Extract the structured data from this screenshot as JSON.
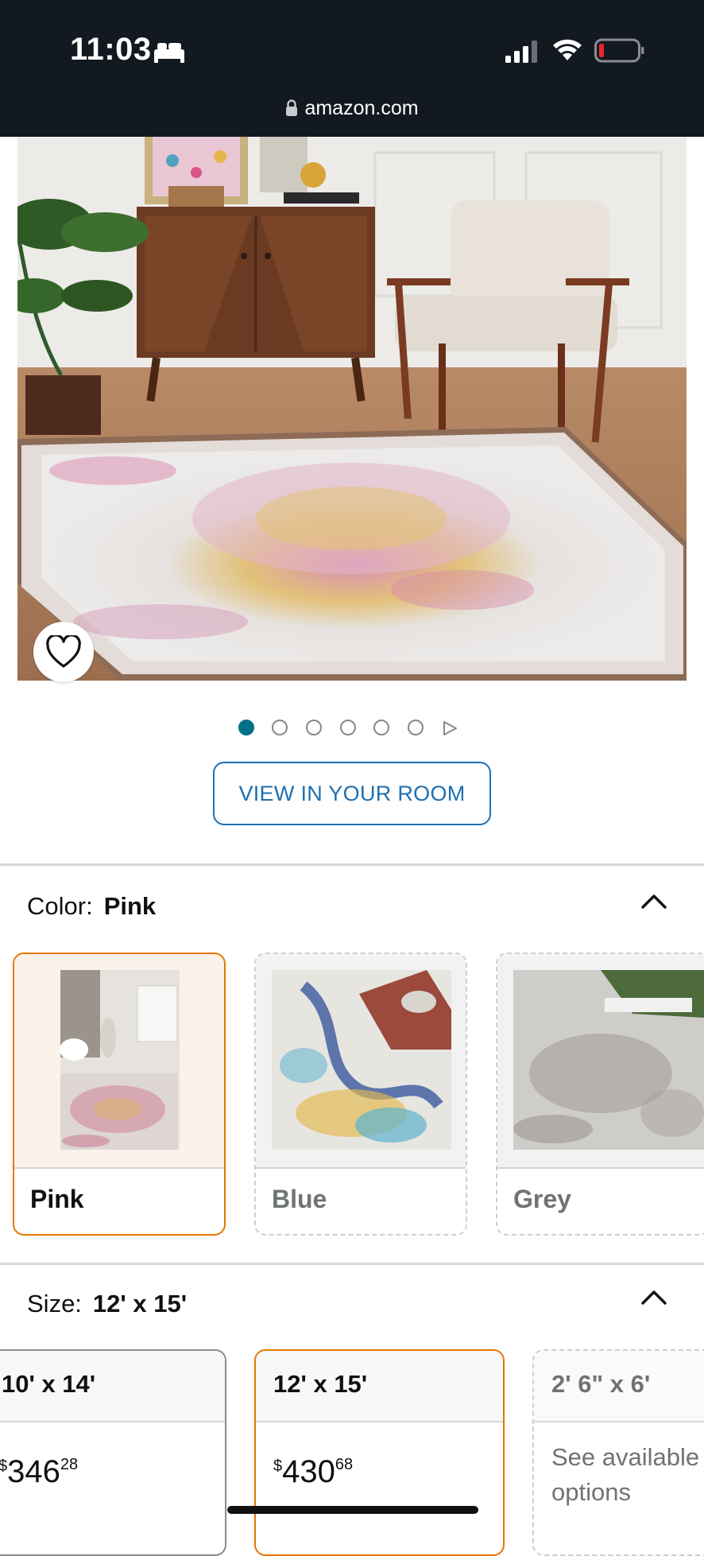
{
  "status_bar": {
    "time": "11:03",
    "url": "amazon.com"
  },
  "product_image": {
    "dots_total": 6,
    "active_dot": 0
  },
  "view_in_room": "VIEW IN YOUR ROOM",
  "color": {
    "label": "Color:",
    "selected": "Pink",
    "options": [
      {
        "name": "Pink"
      },
      {
        "name": "Blue"
      },
      {
        "name": "Grey"
      }
    ]
  },
  "size": {
    "label": "Size:",
    "selected": "12' x 15'",
    "options": [
      {
        "name": "10' x 14'",
        "currency": "$",
        "whole": "346",
        "cents": "28"
      },
      {
        "name": "12' x 15'",
        "currency": "$",
        "whole": "430",
        "cents": "68"
      },
      {
        "name": "2' 6\" x 6'",
        "note": "See available options"
      }
    ]
  },
  "colors": {
    "accent": "#007185",
    "selected_border": "#e77600",
    "button_blue": "#1e6fb0",
    "status_bar_bg": "#131921"
  }
}
